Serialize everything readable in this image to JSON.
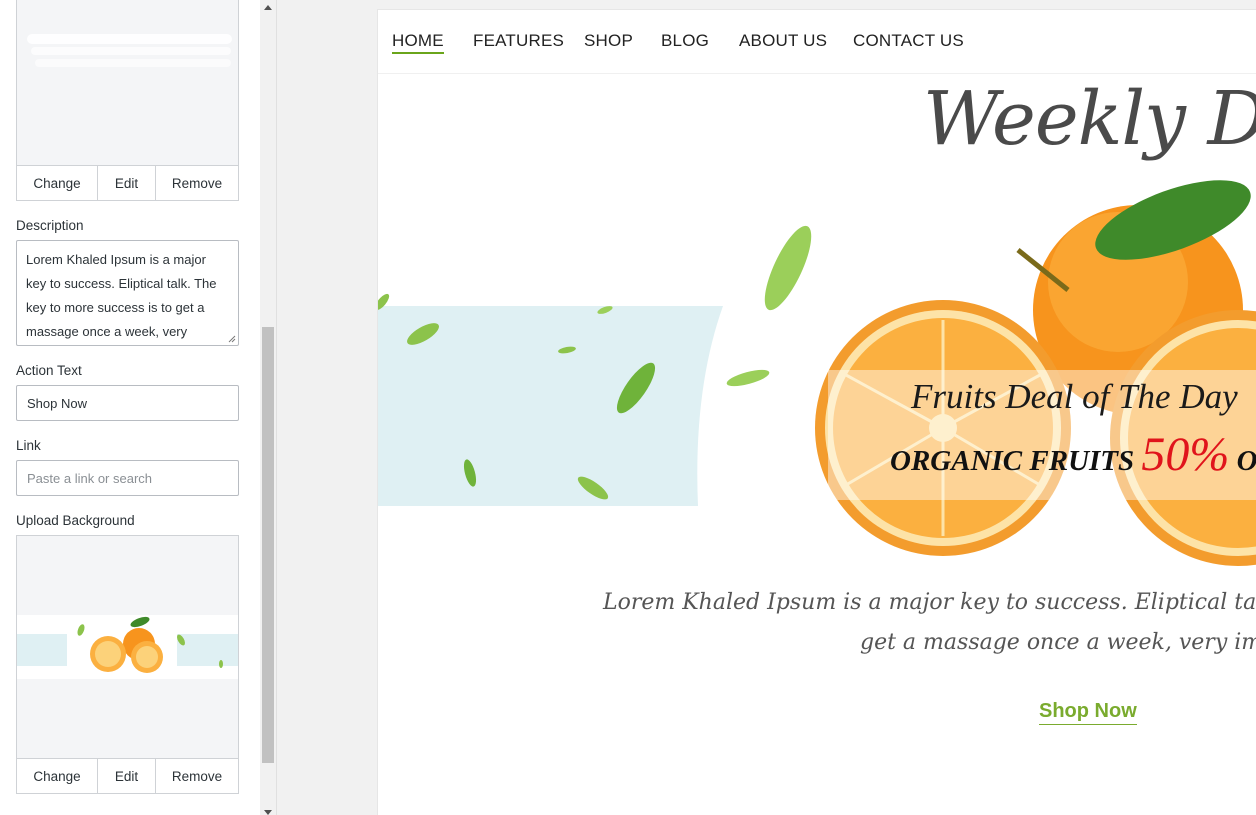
{
  "panel": {
    "top_image_buttons": {
      "change": "Change",
      "edit": "Edit",
      "remove": "Remove"
    },
    "description": {
      "label": "Description",
      "value": "Lorem Khaled Ipsum is a major key to success. Eliptical talk. The key to more success is to get a massage once a week, very"
    },
    "action_text": {
      "label": "Action Text",
      "value": "Shop Now"
    },
    "link": {
      "label": "Link",
      "placeholder": "Paste a link or search"
    },
    "upload_background": {
      "label": "Upload Background"
    },
    "bottom_image_buttons": {
      "change": "Change",
      "edit": "Edit",
      "remove": "Remove"
    }
  },
  "preview": {
    "nav": [
      "HOME",
      "FEATURES",
      "SHOP",
      "BLOG",
      "ABOUT US",
      "CONTACT US"
    ],
    "active_nav": "HOME",
    "hero": {
      "title": "Weekly Deal",
      "deal_line1": "Fruits Deal of The Day",
      "deal_line2_prefix": "ORGANIC FRUITS ",
      "deal_percent": "50%",
      "deal_line2_suffix": " OFF",
      "description_line1": "Lorem Khaled Ipsum is a major key to success. Eliptical talk. The key to more success is to",
      "description_line2": "get a massage once a week, very important",
      "action": "Shop Now"
    }
  },
  "colors": {
    "accent_green": "#7aab2e",
    "nav_underline": "#6aa51b",
    "deal_red": "#e0141b",
    "banner_band": "#dff0f3",
    "orange": "#f7941d"
  }
}
